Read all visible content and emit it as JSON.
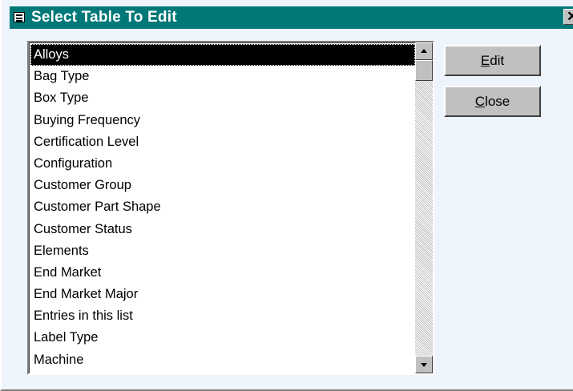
{
  "window": {
    "title": "Select Table To Edit",
    "close_glyph": "✕"
  },
  "list": {
    "items": [
      "Alloys",
      "Bag Type",
      "Box Type",
      "Buying Frequency",
      "Certification Level",
      "Configuration",
      "Customer Group",
      "Customer Part Shape",
      "Customer Status",
      "Elements",
      "End Market",
      "End Market Major",
      "Entries in this list",
      "Label Type",
      "Machine"
    ],
    "selected": "Alloys"
  },
  "buttons": {
    "edit": {
      "mnemonic": "E",
      "rest": "dit"
    },
    "close": {
      "mnemonic": "C",
      "rest": "lose"
    }
  },
  "colors": {
    "titlebar": "#007878",
    "background": "#eef4fc",
    "button_face": "#c0c0c0",
    "selection": "#000000"
  },
  "icons": {
    "title": "form-icon",
    "scroll_up": "arrow-up-icon",
    "scroll_down": "arrow-down-icon"
  }
}
